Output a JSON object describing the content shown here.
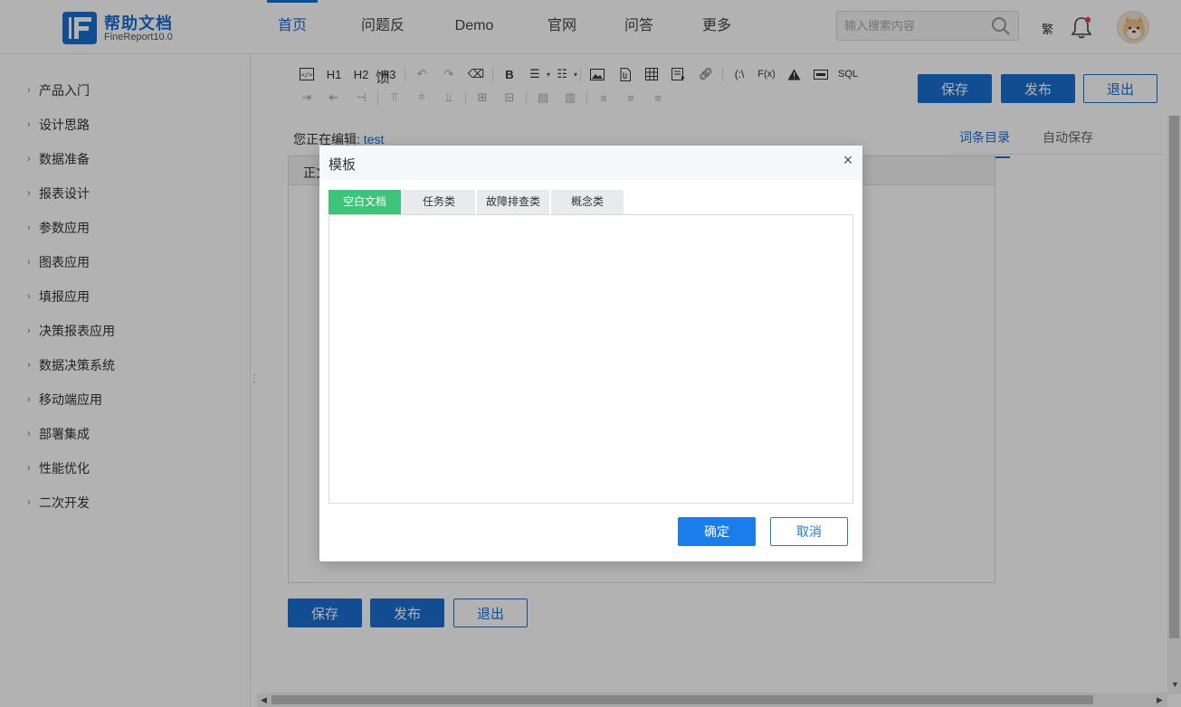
{
  "header": {
    "logo_title": "帮助文档",
    "logo_subtitle": "FineReport10.0",
    "nav": [
      "首页",
      "问题反馈",
      "Demo",
      "官网",
      "问答",
      "更多"
    ],
    "active_nav": "首页",
    "search_placeholder": "输入搜索内容",
    "traditional_toggle": "繁",
    "icons": [
      "search-icon",
      "bell-icon",
      "avatar"
    ],
    "notification_color": "#e8453c"
  },
  "sidebar": {
    "items": [
      "产品入门",
      "设计思路",
      "数据准备",
      "报表设计",
      "参数应用",
      "图表应用",
      "填报应用",
      "决策报表应用",
      "数据决策系统",
      "移动端应用",
      "部署集成",
      "性能优化",
      "二次开发"
    ]
  },
  "toolbar": {
    "row1": [
      "code-icon",
      "H1",
      "H2",
      "H3",
      "undo-icon",
      "redo-icon",
      "eraser-icon",
      "B",
      "ordered-list-icon",
      "bullet-list-icon",
      "image-icon",
      "attachment-icon",
      "table-icon",
      "template-icon",
      "link-icon",
      "(:\\",
      "F(x)",
      "warning-icon",
      "panel-icon",
      "SQL"
    ],
    "row2_icons": [
      "indent-icon",
      "outdent-icon",
      "anchor-icon",
      "align-top-icon",
      "align-middle-icon",
      "align-bottom-icon",
      "merge-cells-icon",
      "split-cells-icon",
      "insert-row-icon",
      "insert-col-icon",
      "align-left-icon",
      "align-center-icon",
      "align-right-icon"
    ],
    "save_label": "保存",
    "publish_label": "发布",
    "exit_label": "退出"
  },
  "editor": {
    "editing_label": "您正在编辑:",
    "doc_name": "test",
    "body_head": "正文",
    "right_tabs": [
      "词条目录",
      "自动保存"
    ],
    "active_right_tab": "词条目录"
  },
  "bottom_actions": {
    "save_label": "保存",
    "publish_label": "发布",
    "exit_label": "退出"
  },
  "modal": {
    "title": "模板",
    "tabs": [
      "空白文档",
      "任务类",
      "故障排查类",
      "概念类"
    ],
    "active_tab": "空白文档",
    "ok_label": "确定",
    "cancel_label": "取消",
    "colors": {
      "active_tab": "#3ec47a",
      "ok": "#1a7dea"
    }
  },
  "colors": {
    "brand": "#1a6fd1",
    "overlay": "rgba(0,0,0,0.30)"
  }
}
